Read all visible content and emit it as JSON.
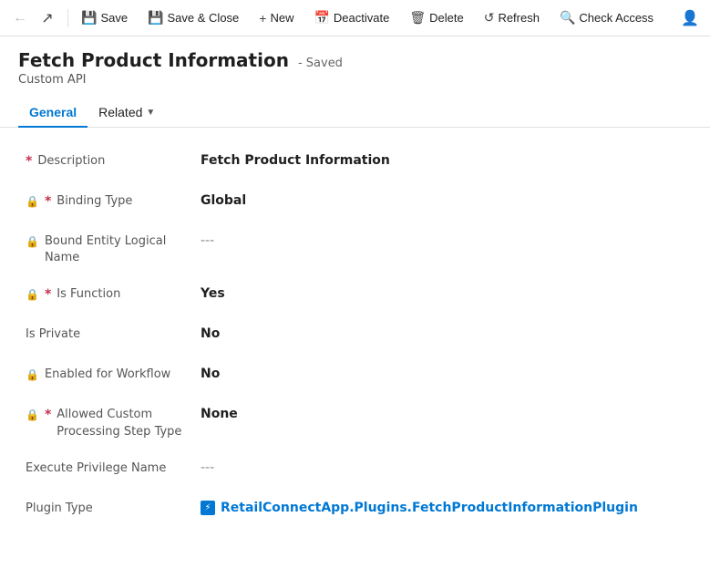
{
  "toolbar": {
    "back_icon": "←",
    "forward_icon": "↗",
    "save_label": "Save",
    "save_close_label": "Save & Close",
    "new_label": "New",
    "deactivate_label": "Deactivate",
    "delete_label": "Delete",
    "refresh_label": "Refresh",
    "check_access_label": "Check Access",
    "user_icon": "👤"
  },
  "page": {
    "title": "Fetch Product Information",
    "saved_status": "- Saved",
    "subtitle": "Custom API"
  },
  "tabs": [
    {
      "id": "general",
      "label": "General",
      "active": true,
      "has_dropdown": false
    },
    {
      "id": "related",
      "label": "Related",
      "active": false,
      "has_dropdown": true
    }
  ],
  "fields": [
    {
      "id": "description",
      "label": "Description",
      "required": true,
      "locked": false,
      "value": "Fetch Product Information",
      "empty": false,
      "is_link": false
    },
    {
      "id": "binding_type",
      "label": "Binding Type",
      "required": true,
      "locked": true,
      "value": "Global",
      "empty": false,
      "is_link": false
    },
    {
      "id": "bound_entity_logical_name",
      "label": "Bound Entity Logical Name",
      "required": false,
      "locked": true,
      "value": "---",
      "empty": true,
      "is_link": false
    },
    {
      "id": "is_function",
      "label": "Is Function",
      "required": true,
      "locked": true,
      "value": "Yes",
      "empty": false,
      "is_link": false
    },
    {
      "id": "is_private",
      "label": "Is Private",
      "required": false,
      "locked": false,
      "value": "No",
      "empty": false,
      "is_link": false
    },
    {
      "id": "enabled_for_workflow",
      "label": "Enabled for Workflow",
      "required": false,
      "locked": true,
      "value": "No",
      "empty": false,
      "is_link": false
    },
    {
      "id": "allowed_custom_processing_step_type",
      "label": "Allowed Custom Processing Step Type",
      "required": true,
      "locked": true,
      "value": "None",
      "empty": false,
      "is_link": false
    },
    {
      "id": "execute_privilege_name",
      "label": "Execute Privilege Name",
      "required": false,
      "locked": false,
      "value": "---",
      "empty": true,
      "is_link": false
    },
    {
      "id": "plugin_type",
      "label": "Plugin Type",
      "required": false,
      "locked": false,
      "value": "RetailConnectApp.Plugins.FetchProductInformationPlugin",
      "empty": false,
      "is_link": true
    }
  ]
}
